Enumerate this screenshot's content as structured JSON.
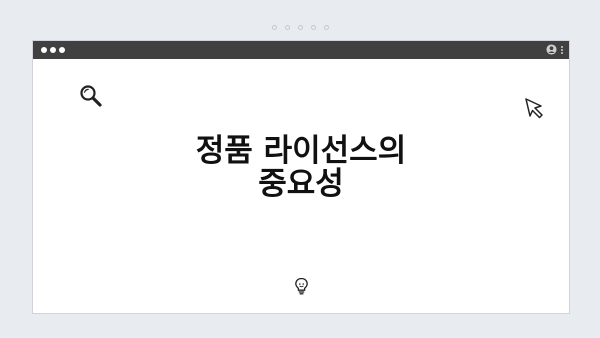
{
  "page": {
    "title_line1": "정품 라이선스의",
    "title_line2": "중요성"
  },
  "icons": {
    "search": "search-icon",
    "cursor": "cursor-arrow-icon",
    "bulb": "lightbulb-icon",
    "user": "user-icon",
    "menu": "kebab-menu-icon"
  },
  "colors": {
    "background": "#e8ecf1",
    "titlebar": "#404040",
    "window": "#ffffff",
    "text": "#111111"
  }
}
